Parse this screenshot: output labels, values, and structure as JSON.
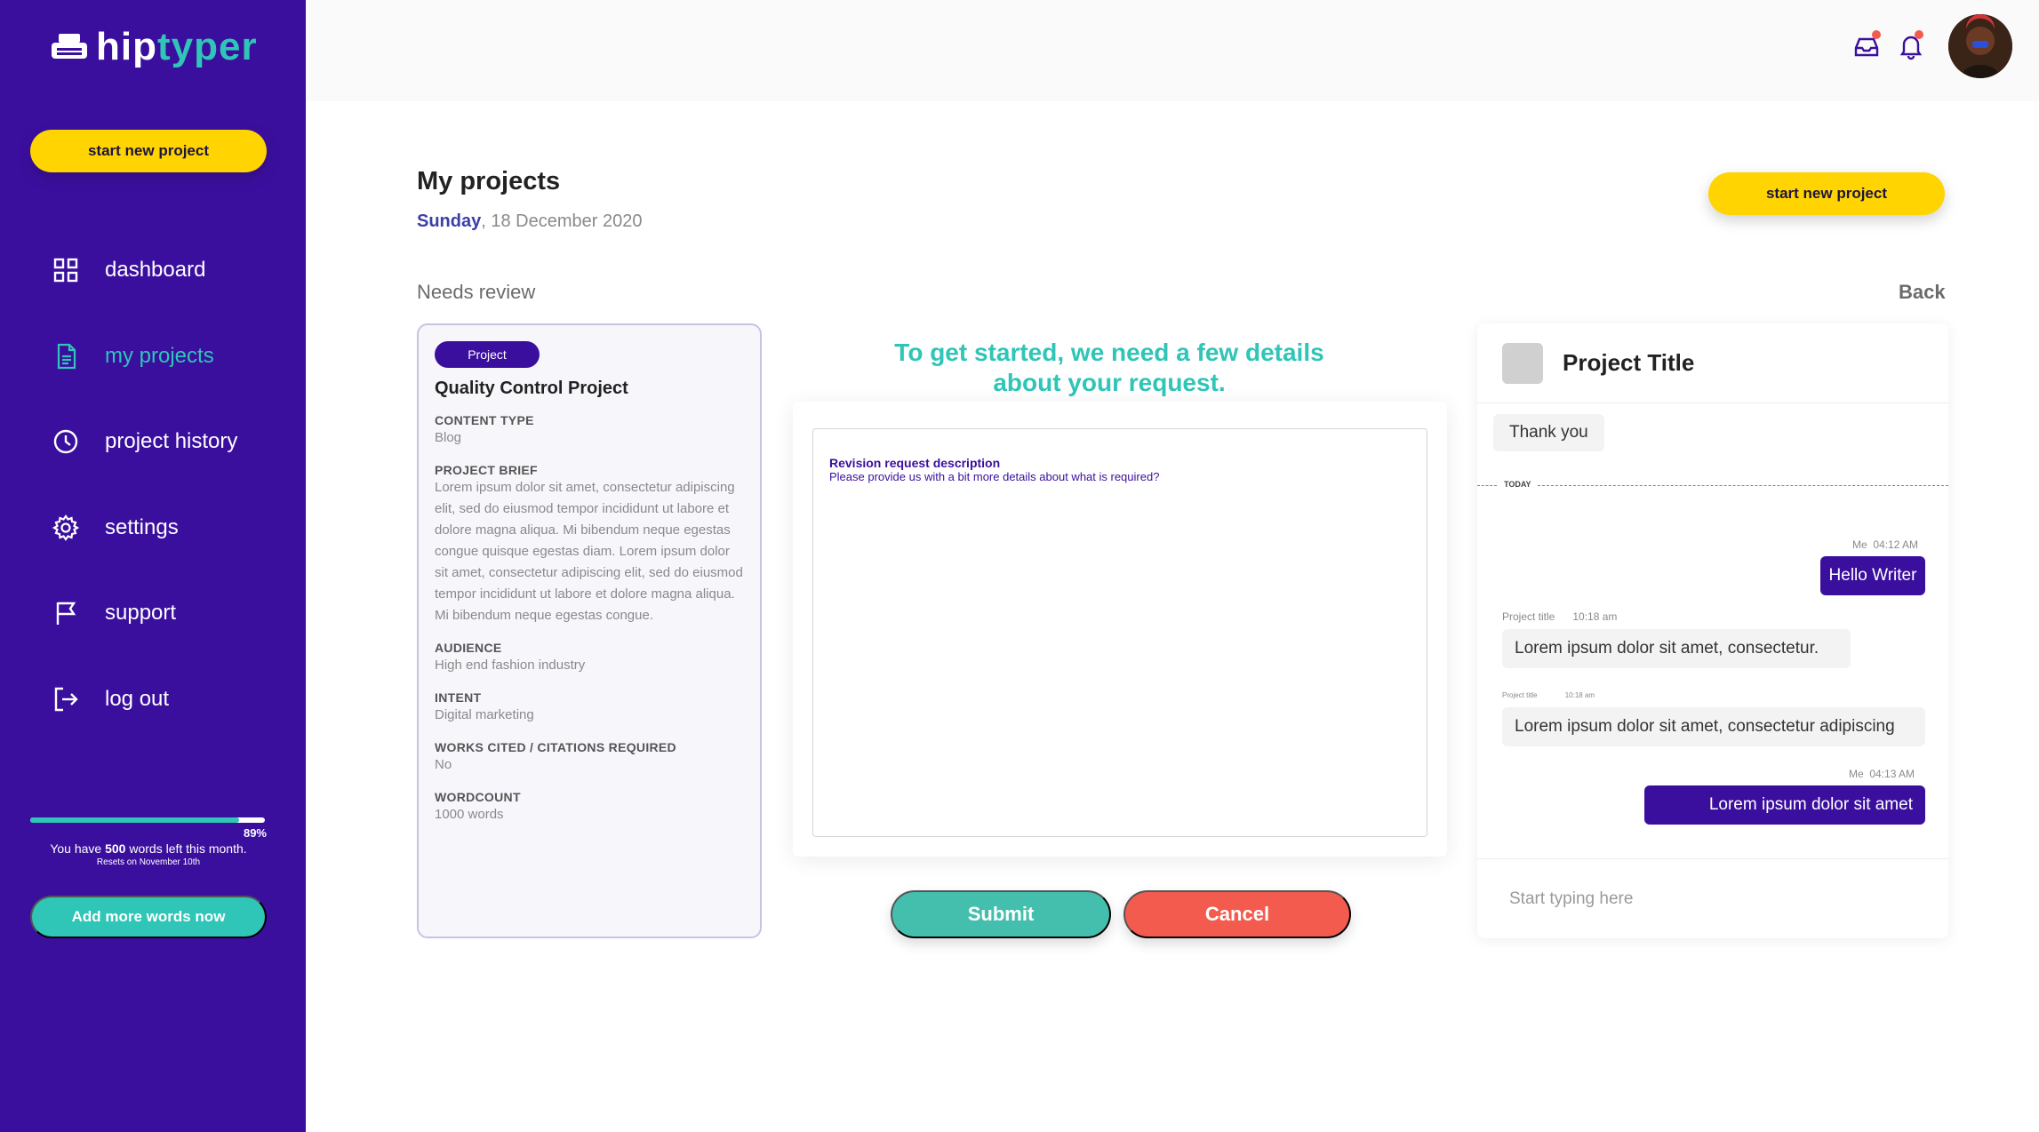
{
  "brand": {
    "hip": "hip",
    "typer": "typer"
  },
  "sidebar": {
    "new_project_label": "start new project",
    "nav": [
      {
        "label": "dashboard",
        "icon": "grid-icon",
        "active": false
      },
      {
        "label": "my projects",
        "icon": "document-icon",
        "active": true
      },
      {
        "label": "project history",
        "icon": "clock-icon",
        "active": false
      },
      {
        "label": "settings",
        "icon": "gear-icon",
        "active": false
      },
      {
        "label": "support",
        "icon": "flag-icon",
        "active": false
      },
      {
        "label": "log out",
        "icon": "logout-icon",
        "active": false
      }
    ],
    "usage": {
      "percent_label": "89%",
      "progress": 0.89,
      "prefix": "You have",
      "words": "500",
      "suffix": "words left this month.",
      "reset": "Resets on November 10th"
    },
    "add_words_label": "Add more words now"
  },
  "header": {
    "inbox_icon": "inbox-icon",
    "bell_icon": "bell-icon",
    "accent_dot": "#f45b4f"
  },
  "main": {
    "title": "My projects",
    "date_day": "Sunday",
    "date_rest": ", 18 December 2020",
    "new_project_label": "start new project",
    "section": "Needs review",
    "back": "Back"
  },
  "project": {
    "tag": "Project",
    "title": "Quality Control Project",
    "fields": [
      {
        "label": "CONTENT TYPE",
        "value": "Blog"
      },
      {
        "label": "PROJECT BRIEF",
        "value": "Lorem ipsum dolor sit amet, consectetur adipiscing elit, sed do eiusmod tempor incididunt ut labore et dolore magna aliqua. Mi bibendum neque egestas congue quisque egestas diam. Lorem ipsum dolor sit amet, consectetur adipiscing elit, sed do eiusmod tempor incididunt ut labore et dolore magna aliqua. Mi bibendum neque egestas congue."
      },
      {
        "label": "AUDIENCE",
        "value": "High end fashion industry"
      },
      {
        "label": "INTENT",
        "value": "Digital marketing"
      },
      {
        "label": "WORKS CITED / CITATIONS REQUIRED",
        "value": "No"
      },
      {
        "label": "WORDCOUNT",
        "value": "1000 words"
      }
    ]
  },
  "form": {
    "heading_line1": "To get started, we need a few details",
    "heading_line2": "about your request.",
    "label": "Revision request description",
    "hint": "Please provide us with a bit more details about what is required?",
    "submit": "Submit",
    "cancel": "Cancel"
  },
  "chat": {
    "title": "Project Title",
    "today": "TODAY",
    "placeholder": "Start typing here",
    "messages": [
      {
        "text": "Thank you",
        "sender": "",
        "time": ""
      },
      {
        "text": "Hello Writer",
        "sender": "Me",
        "time": "04:12 AM"
      },
      {
        "text": "Lorem ipsum dolor sit amet, consectetur.",
        "sender": "Project title",
        "time": "10:18 am"
      },
      {
        "text": "Lorem ipsum dolor sit amet, consectetur adipiscing",
        "sender": "Project title",
        "time": "10:18 am"
      },
      {
        "text": "Lorem ipsum dolor sit amet",
        "sender": "Me",
        "time": "04:13 AM"
      }
    ]
  },
  "colors": {
    "sidebar": "#3b0f9e",
    "teal": "#2fc5b7",
    "yellow": "#ffd400",
    "red": "#f45b4f"
  }
}
